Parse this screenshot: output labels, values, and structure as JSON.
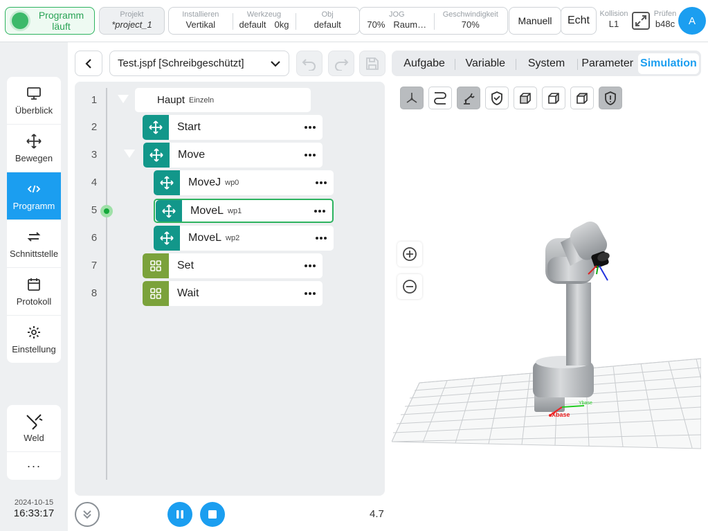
{
  "header": {
    "run_status": "Programm läuft",
    "project_label": "Projekt",
    "project_value": "*project_1",
    "install_label": "Installieren",
    "install_value": "Vertikal",
    "tool_label": "Werkzeug",
    "tool_value_a": "default",
    "tool_value_b": "0kg",
    "obj_label": "Obj",
    "obj_value": "default",
    "jog_label": "JOG",
    "jog_value_a": "70%",
    "jog_value_b": "Raum…",
    "speed_label": "Geschwindigkeit",
    "speed_value": "70%",
    "mode_manual": "Manuell",
    "mode_real": "Echt",
    "collision_label": "Kollision",
    "collision_value": "L1",
    "check_label": "Prüfen",
    "check_value": "b48c",
    "avatar_initial": "A"
  },
  "nav": {
    "items": [
      {
        "label": "Überblick",
        "icon": "monitor-icon"
      },
      {
        "label": "Bewegen",
        "icon": "move-icon"
      },
      {
        "label": "Programm",
        "icon": "code-icon",
        "active": true
      },
      {
        "label": "Schnittstelle",
        "icon": "swap-icon"
      },
      {
        "label": "Protokoll",
        "icon": "calendar-icon"
      },
      {
        "label": "Einstellung",
        "icon": "gear-icon"
      }
    ],
    "weld_label": "Weld",
    "more_label": "···"
  },
  "datetime": {
    "date": "2024-10-15",
    "time": "16:33:17"
  },
  "program": {
    "file_name": "Test.jspf [Schreibgeschützt]",
    "lines": [
      "1",
      "2",
      "3",
      "4",
      "5",
      "6",
      "7",
      "8"
    ],
    "nodes": [
      {
        "name": "Haupt",
        "sub": "Einzeln"
      },
      {
        "name": "Start",
        "sub": ""
      },
      {
        "name": "Move",
        "sub": ""
      },
      {
        "name": "MoveJ",
        "sub": "wp0"
      },
      {
        "name": "MoveL",
        "sub": "wp1"
      },
      {
        "name": "MoveL",
        "sub": "wp2"
      },
      {
        "name": "Set",
        "sub": ""
      },
      {
        "name": "Wait",
        "sub": ""
      }
    ],
    "version": "4.7"
  },
  "tabs": [
    "Aufgabe",
    "Variable",
    "System",
    "Parameter",
    "Simulation"
  ],
  "simulation": {
    "axis_x": "Xbase",
    "axis_y": "Ybase"
  },
  "colors": {
    "accent": "#1b9ef0",
    "run_green": "#2db35f",
    "teal": "#12978a",
    "olive": "#7ba23b"
  }
}
